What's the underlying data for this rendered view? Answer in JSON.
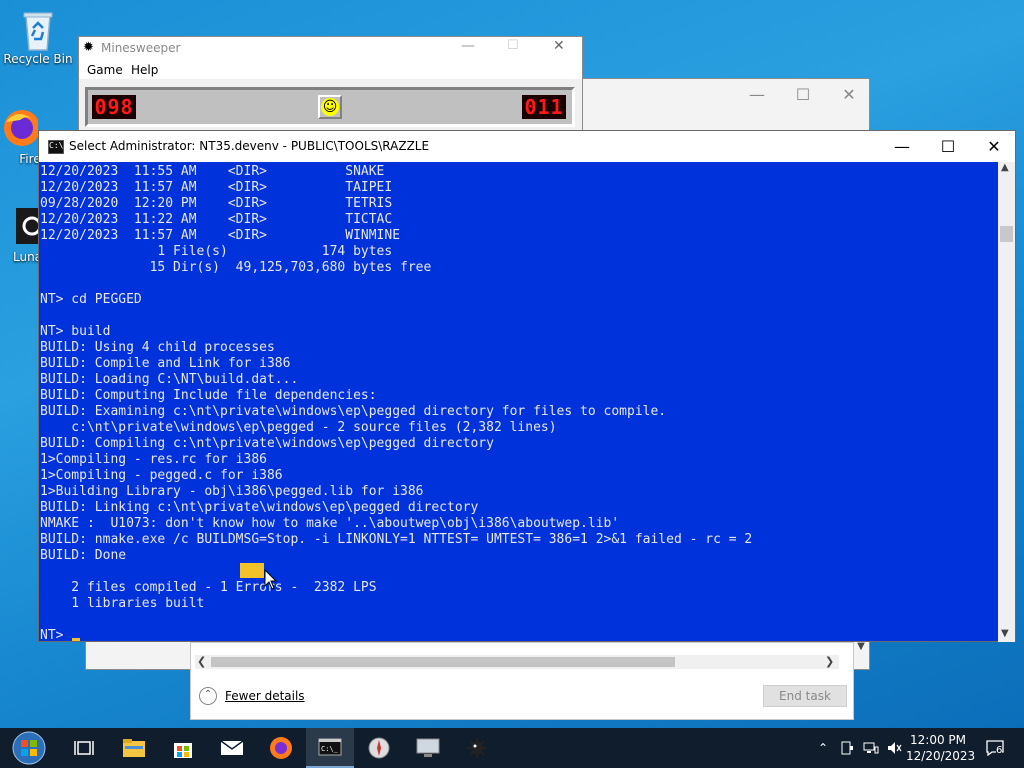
{
  "desktop": {
    "icons": [
      {
        "label": "Recycle Bin"
      },
      {
        "label": "Fire"
      },
      {
        "label": "Lunar"
      }
    ]
  },
  "minesweeper": {
    "title": "Minesweeper",
    "menu": [
      "Game",
      "Help"
    ],
    "mines_counter": "098",
    "timer": "011",
    "face": "☺"
  },
  "console": {
    "title": "Select Administrator:  NT35.devenv  - PUBLIC\\TOOLS\\RAZZLE",
    "lines": [
      "12/20/2023  11:55 AM    <DIR>          SNAKE",
      "12/20/2023  11:57 AM    <DIR>          TAIPEI",
      "09/28/2020  12:20 PM    <DIR>          TETRIS",
      "12/20/2023  11:22 AM    <DIR>          TICTAC",
      "12/20/2023  11:57 AM    <DIR>          WINMINE",
      "               1 File(s)            174 bytes",
      "              15 Dir(s)  49,125,703,680 bytes free",
      "",
      "NT> cd PEGGED",
      "",
      "NT> build",
      "BUILD: Using 4 child processes",
      "BUILD: Compile and Link for i386",
      "BUILD: Loading C:\\NT\\build.dat...",
      "BUILD: Computing Include file dependencies:",
      "BUILD: Examining c:\\nt\\private\\windows\\ep\\pegged directory for files to compile.",
      "    c:\\nt\\private\\windows\\ep\\pegged - 2 source files (2,382 lines)",
      "BUILD: Compiling c:\\nt\\private\\windows\\ep\\pegged directory",
      "1>Compiling - res.rc for i386",
      "1>Compiling - pegged.c for i386",
      "1>Building Library - obj\\i386\\pegged.lib for i386",
      "BUILD: Linking c:\\nt\\private\\windows\\ep\\pegged directory",
      "NMAKE :  U1073: don't know how to make '..\\aboutwep\\obj\\i386\\aboutwep.lib'",
      "BUILD: nmake.exe /c BUILDMSG=Stop. -i LINKONLY=1 NTTEST= UMTEST= 386=1 2>&1 failed - rc = 2",
      "BUILD: Done",
      "",
      "    2 files compiled - 1 Errors -  2382 LPS",
      "    1 libraries built",
      "",
      "NT> "
    ]
  },
  "task_manager": {
    "fewer_details": "Fewer details",
    "end_task": "End task"
  },
  "taskbar": {
    "apps": [
      "start-icon",
      "task-view-icon",
      "file-explorer-icon",
      "store-icon",
      "mail-icon",
      "firefox-icon",
      "terminal-icon",
      "compass-icon",
      "monitor-icon",
      "minesweeper-icon"
    ],
    "time": "12:00 PM",
    "date": "12/20/2023",
    "notifications": "6"
  },
  "colors": {
    "console_bg": "#0032dc",
    "console_text": "#e8e8e8",
    "taskbar_bg": "#0f1d2d",
    "lcd_red": "#ff1a1a"
  }
}
